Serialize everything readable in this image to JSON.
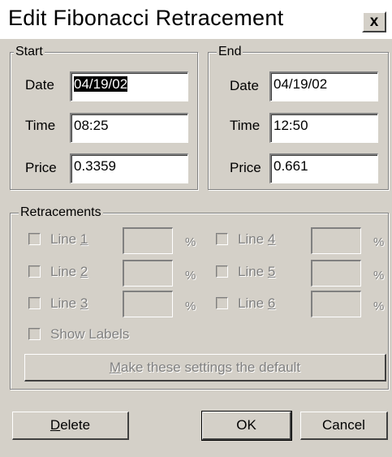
{
  "dialog": {
    "title": "Edit Fibonacci Retracement",
    "close_glyph": "x"
  },
  "start": {
    "legend": "Start",
    "date_label": "Date",
    "date_value": "04/19/02",
    "time_label": "Time",
    "time_value": "08:25",
    "price_label": "Price",
    "price_value": "0.3359"
  },
  "end": {
    "legend": "End",
    "date_label": "Date",
    "date_value": "04/19/02",
    "time_label": "Time",
    "time_value": "12:50",
    "price_label": "Price",
    "price_value": "0.661"
  },
  "retracements": {
    "legend": "Retracements",
    "percent_sign": "%",
    "lines": [
      {
        "prefix": "Line ",
        "num": "1",
        "checked": false
      },
      {
        "prefix": "Line ",
        "num": "2",
        "checked": false
      },
      {
        "prefix": "Line ",
        "num": "3",
        "checked": false
      },
      {
        "prefix": "Line ",
        "num": "4",
        "checked": false
      },
      {
        "prefix": "Line ",
        "num": "5",
        "checked": false
      },
      {
        "prefix": "Line ",
        "num": "6",
        "checked": false
      }
    ],
    "show_labels": "Show Labels",
    "default_btn": {
      "ul": "M",
      "rest": "ake these settings the default"
    }
  },
  "buttons": {
    "delete": {
      "ul": "D",
      "rest": "elete"
    },
    "ok": "OK",
    "cancel": "Cancel"
  }
}
